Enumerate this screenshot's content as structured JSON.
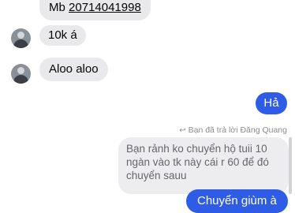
{
  "messages": {
    "m1": {
      "prefix": "Mb ",
      "number": "20714041998"
    },
    "m2": {
      "text": "10k á"
    },
    "m3": {
      "text": "Aloo aloo"
    },
    "m4": {
      "text": "Hả"
    },
    "reply_note": "Bạn đã trả lời Đăng Quang",
    "quoted": "Bạn rảnh ko chuyển hộ tuii 10 ngàn vào tk này cái r 60 để đó chuyển sauu",
    "m5": {
      "text": "Chuyển giùm à"
    }
  },
  "colors": {
    "outgoing": "#2f5ce6",
    "incoming": "#e9e9eb"
  },
  "icons": {
    "reply": "reply-arrow-icon"
  }
}
